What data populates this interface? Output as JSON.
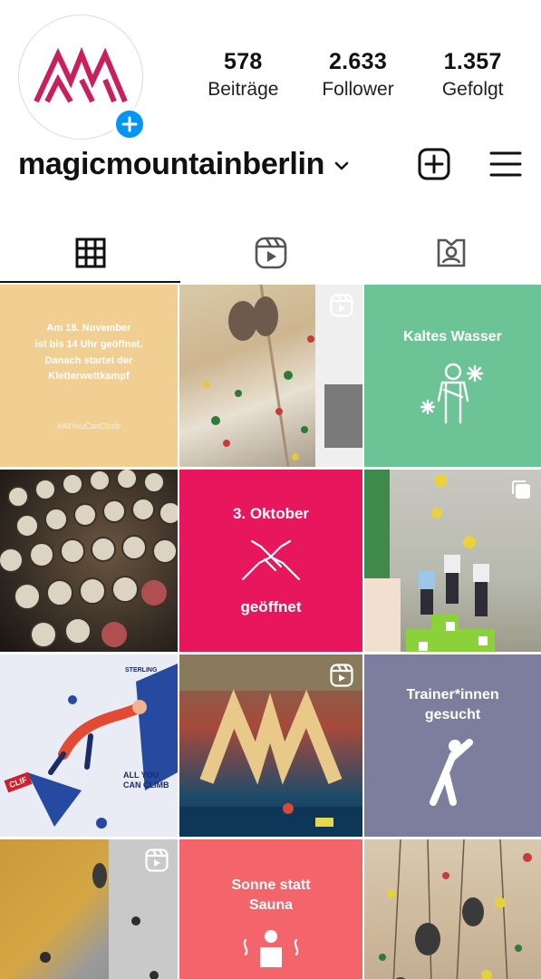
{
  "profile": {
    "username": "magicmountainberlin",
    "stats": [
      {
        "value": "578",
        "label": "Beiträge"
      },
      {
        "value": "2.633",
        "label": "Follower"
      },
      {
        "value": "1.357",
        "label": "Gefolgt"
      }
    ]
  },
  "tabs": [
    {
      "icon": "grid-icon",
      "active": true
    },
    {
      "icon": "reels-icon",
      "active": false
    },
    {
      "icon": "tagged-icon",
      "active": false
    }
  ],
  "posts": {
    "post1": {
      "lines": [
        "Am 18. November",
        "ist bis 14 Uhr geöffnet.",
        "Danach startet der",
        "Kletterwettkampf"
      ],
      "hashtag": "#AllYouCanClimb",
      "bg": "#f1cf92"
    },
    "post3": {
      "title": "Kaltes Wasser",
      "bg": "#6cc395"
    },
    "post5": {
      "title": "3. Oktober",
      "subtitle": "geöffnet",
      "bg": "#e8175d"
    },
    "post7": {
      "brand": "STERLING",
      "line1": "ALL YOU",
      "line2": "CAN CLIMB",
      "tag": "CLIF"
    },
    "post9": {
      "title1": "Trainer*innen",
      "title2": "gesucht",
      "bg": "#7d7e9e"
    },
    "post11": {
      "title1": "Sonne statt",
      "title2": "Sauna",
      "bg": "#f3656a"
    }
  },
  "colors": {
    "accent": "#0095f6",
    "brand": "#c8205d"
  }
}
